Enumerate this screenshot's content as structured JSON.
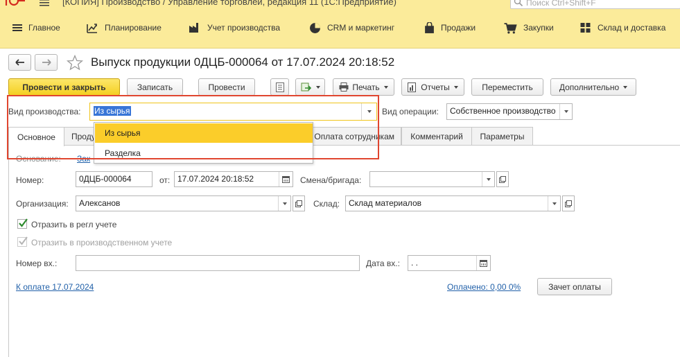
{
  "titlebar": {
    "title": "[КОПИЯ] Производство / Управление торговлей, редакция 11  (1С:Предприятие)",
    "search_placeholder": "Поиск Ctrl+Shift+F"
  },
  "sections": [
    {
      "label": "Главное",
      "icon": "hamburger-icon"
    },
    {
      "label": "Планирование",
      "icon": "planning-icon"
    },
    {
      "label": "Учет производства",
      "icon": "factory-icon"
    },
    {
      "label": "CRM и маркетинг",
      "icon": "pie-chart-icon"
    },
    {
      "label": "Продажи",
      "icon": "bag-icon"
    },
    {
      "label": "Закупки",
      "icon": "cart-icon"
    },
    {
      "label": "Склад и доставка",
      "icon": "warehouse-icon"
    }
  ],
  "document": {
    "title": "Выпуск продукции 0ДЦБ-000064 от 17.07.2024 20:18:52"
  },
  "toolbar": {
    "post_close": "Провести и закрыть",
    "save": "Записать",
    "post": "Провести",
    "print": "Печать",
    "reports": "Отчеты",
    "move": "Переместить",
    "more": "Дополнительно"
  },
  "form": {
    "production_type_label": "Вид производства:",
    "production_type_value": "Из сырья",
    "operation_type_label": "Вид операции:",
    "operation_type_value": "Собственное производство",
    "basis_label": "Основание:",
    "basis_value": "Зак",
    "number_label": "Номер:",
    "number_value": "0ДЦБ-000064",
    "date_from_label": "от:",
    "date_value": "17.07.2024 20:18:52",
    "shift_label": "Смена/бригада:",
    "shift_value": "",
    "org_label": "Организация:",
    "org_value": "Алексанов",
    "warehouse_label": "Склад:",
    "warehouse_value": "Склад материалов",
    "reg_accounting_label": "Отразить в регл учете",
    "reg_accounting_checked": true,
    "prod_accounting_label": "Отразить в производственном учете",
    "prod_accounting_checked": true,
    "incoming_number_label": "Номер вх.:",
    "incoming_number_value": "",
    "incoming_date_label": "Дата вх.:",
    "incoming_date_value": " .  .",
    "payment_link": "К оплате 17.07.2024",
    "paid_link": "Оплачено: 0,00  0%",
    "offset_button": "Зачет оплаты"
  },
  "tabs": [
    {
      "label": "Основное",
      "active": true
    },
    {
      "label": "Продукция"
    },
    {
      "label": "Оплата сотрудникам"
    },
    {
      "label": "Комментарий"
    },
    {
      "label": "Параметры"
    }
  ],
  "dropdown": {
    "items": [
      "Из сырья",
      "Разделка"
    ],
    "selected_index": 0
  },
  "colors": {
    "panel": "#fbeb9a",
    "primary_button": "#f4cf22",
    "dropdown_selected": "#fbcd2a",
    "highlight_box": "#e0452f",
    "link": "#1f5fa8",
    "checkbox_mark": "#2e8b2e"
  }
}
